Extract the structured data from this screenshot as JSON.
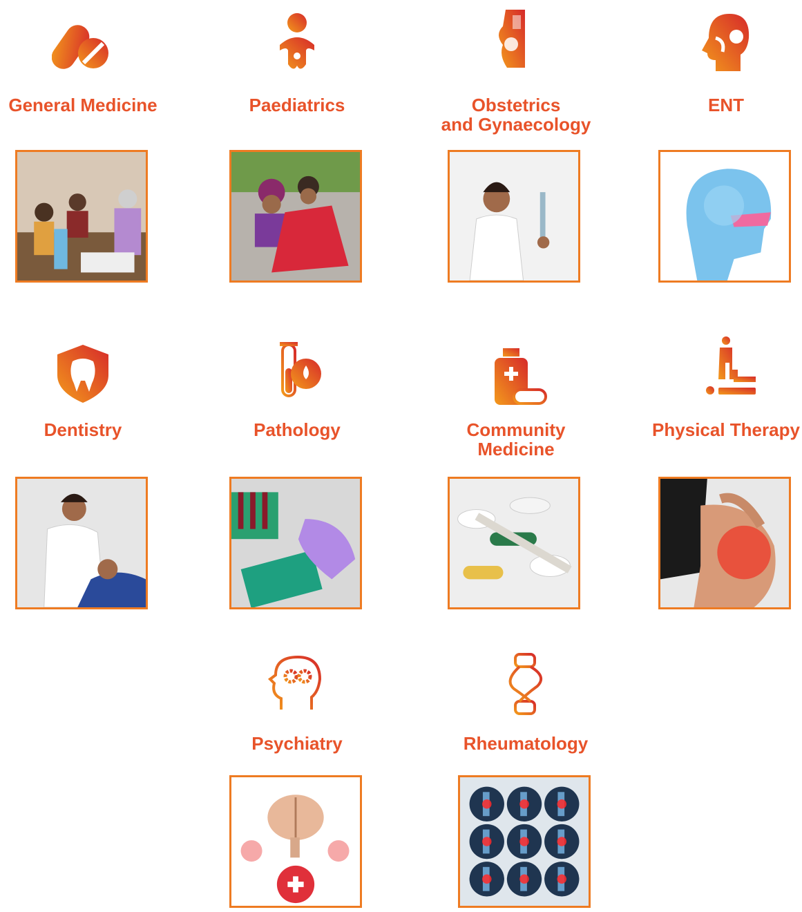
{
  "specialties": [
    {
      "id": "general-medicine",
      "label_lines": [
        "General Medicine"
      ],
      "icon": "pill-capsule-icon",
      "photo": "doctor-examining-elderly-patients"
    },
    {
      "id": "paediatrics",
      "label_lines": [
        "Paediatrics"
      ],
      "icon": "baby-icon",
      "photo": "mother-holding-child"
    },
    {
      "id": "obstetrics",
      "label_lines": [
        "Obstetrics",
        "and Gynaecology"
      ],
      "icon": "pregnant-woman-icon",
      "photo": "nurse-with-syringe"
    },
    {
      "id": "ent",
      "label_lines": [
        "ENT"
      ],
      "icon": "head-profile-ent-icon",
      "photo": "head-xray-sinus"
    },
    {
      "id": "dentistry",
      "label_lines": [
        "Dentistry"
      ],
      "icon": "tooth-shield-icon",
      "photo": "dentist-with-patient"
    },
    {
      "id": "pathology",
      "label_lines": [
        "Pathology"
      ],
      "icon": "test-tube-drop-icon",
      "photo": "lab-samples-rack"
    },
    {
      "id": "community-medicine",
      "label_lines": [
        "Community",
        "Medicine"
      ],
      "icon": "medicine-bottle-icon",
      "photo": "pills-and-thermometer"
    },
    {
      "id": "physical-therapy",
      "label_lines": [
        "Physical Therapy"
      ],
      "icon": "therapy-massage-icon",
      "photo": "knee-pain"
    },
    {
      "id": "psychiatry",
      "label_lines": [
        "Psychiatry"
      ],
      "icon": "head-gears-icon",
      "photo": "brain-with-plus-signs"
    },
    {
      "id": "rheumatology",
      "label_lines": [
        "Rheumatology"
      ],
      "icon": "joint-bone-icon",
      "photo": "joint-xray-grid"
    }
  ],
  "colors": {
    "label": "#e8532a",
    "gradient_start": "#f39a1c",
    "gradient_end": "#d62a2a",
    "frame": "#ee7b22"
  }
}
